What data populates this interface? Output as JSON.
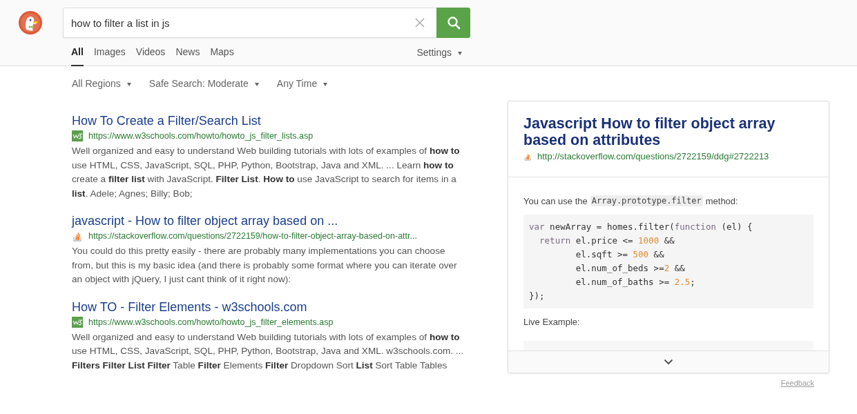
{
  "search": {
    "value": "how to filter a list in js"
  },
  "tabs": [
    {
      "label": "All",
      "selected": true
    },
    {
      "label": "Images",
      "selected": false
    },
    {
      "label": "Videos",
      "selected": false
    },
    {
      "label": "News",
      "selected": false
    },
    {
      "label": "Maps",
      "selected": false
    }
  ],
  "settings": {
    "label": "Settings"
  },
  "filters": [
    {
      "label": "All Regions"
    },
    {
      "label": "Safe Search: Moderate"
    },
    {
      "label": "Any Time"
    }
  ],
  "results": [
    {
      "title": "How To Create a Filter/Search List",
      "kind": "w3",
      "url": "https://www.w3schools.com/howto/howto_js_filter_lists.asp",
      "snippet": "Well organized and easy to understand Web building tutorials with lots of examples of **how to** use HTML, CSS, JavaScript, SQL, PHP, Python, Bootstrap, Java and XML. ... Learn **how to** create a **filter list** with JavaScript. **Filter List**. **How to** use JavaScript to search for items in a **list**. Adele; Agnes; Billy; Bob;"
    },
    {
      "title": "javascript - How to filter object array based on ...",
      "kind": "so",
      "url": "https://stackoverflow.com/questions/2722159/how-to-filter-object-array-based-on-attr...",
      "snippet": "You could do this pretty easily - there are probably many implementations you can choose from, but this is my basic idea (and there is probably some format where you can iterate over an object with jQuery, I just cant think of it right now):"
    },
    {
      "title": "How TO - Filter Elements - w3schools.com",
      "kind": "w3",
      "url": "https://www.w3schools.com/howto/howto_js_filter_elements.asp",
      "snippet": "Well organized and easy to understand Web building tutorials with lots of examples of **how to** use HTML, CSS, JavaScript, SQL, PHP, Python, Bootstrap, Java and XML. w3schools.com. ... **Filters Filter List Filter** Table **Filter** Elements **Filter** Dropdown Sort **List** Sort Table Tables"
    }
  ],
  "answer": {
    "title": "Javascript How to filter object array based on attributes",
    "url": "http://stackoverflow.com/questions/2722159/ddg#2722213",
    "intro_before": "You can use the",
    "intro_code": "Array.prototype.filter",
    "intro_after": "method:",
    "code": [
      [
        {
          "kind": "keyword",
          "text": "var"
        },
        {
          "kind": "plain",
          "text": " newArray = homes.filter("
        },
        {
          "kind": "keyword",
          "text": "function"
        },
        {
          "kind": "plain",
          "text": " (el) {"
        }
      ],
      [
        {
          "kind": "keyword",
          "text": "  return"
        },
        {
          "kind": "plain",
          "text": " el.price <= "
        },
        {
          "kind": "number",
          "text": "1000"
        },
        {
          "kind": "plain",
          "text": " &&"
        }
      ],
      [
        {
          "kind": "plain",
          "text": "         el.sqft >= "
        },
        {
          "kind": "number",
          "text": "500"
        },
        {
          "kind": "plain",
          "text": " &&"
        }
      ],
      [
        {
          "kind": "plain",
          "text": "         el.num_of_beds >="
        },
        {
          "kind": "number",
          "text": "2"
        },
        {
          "kind": "plain",
          "text": " &&"
        }
      ],
      [
        {
          "kind": "plain",
          "text": "         el.num_of_baths >= "
        },
        {
          "kind": "number",
          "text": "2.5"
        },
        {
          "kind": "plain",
          "text": ";"
        }
      ],
      [
        {
          "kind": "plain",
          "text": "});"
        }
      ]
    ],
    "live_label": "Live Example:"
  },
  "feedback": "Feedback"
}
